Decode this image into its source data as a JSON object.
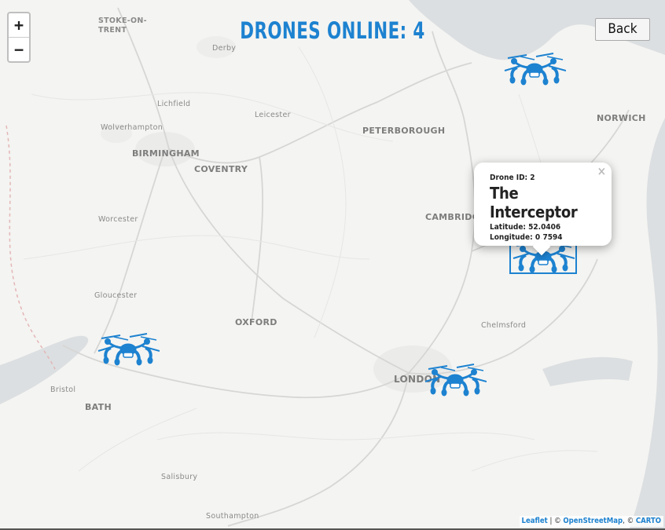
{
  "header": {
    "title": "DRONES ONLINE: 4",
    "back_label": "Back"
  },
  "zoom": {
    "in_label": "+",
    "out_label": "−"
  },
  "popup": {
    "close_label": "×",
    "drone_id": "Drone ID: 2",
    "name": "The Interceptor",
    "latitude": "Latitude: 52.0406",
    "longitude": "Longitude: 0.7594"
  },
  "attribution": {
    "leaflet": "Leaflet",
    "sep1": " | © ",
    "osm": "OpenStreetMap",
    "sep2": ", © ",
    "carto": "CARTO"
  },
  "cities": {
    "stoke": "STOKE-ON-\nTRENT",
    "derby": "Derby",
    "lichfield": "Lichfield",
    "leicester": "Leicester",
    "peterborough": "PETERBOROUGH",
    "norwich": "NORWICH",
    "wolverhampton": "Wolverhampton",
    "birmingham": "BIRMINGHAM",
    "coventry": "COVENTRY",
    "cambridge": "CAMBRIDGE",
    "worcester": "Worcester",
    "gloucester": "Gloucester",
    "oxford": "OXFORD",
    "chelmsford": "Chelmsford",
    "bristol": "Bristol",
    "bath": "BATH",
    "london": "LONDON",
    "salisbury": "Salisbury",
    "southampton": "Southampton"
  },
  "drones": [
    {
      "label": "Drone icon",
      "selected": false
    },
    {
      "label": "Drone icon",
      "selected": true
    },
    {
      "label": "Drone icon",
      "selected": false
    },
    {
      "label": "Drone icon",
      "selected": false
    }
  ],
  "colors": {
    "accent": "#1d82d0",
    "land": "#f4f4f2",
    "sea": "#d9dcde"
  }
}
